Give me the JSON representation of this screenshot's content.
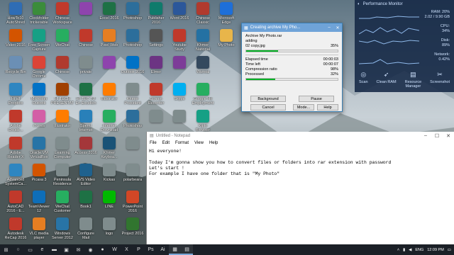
{
  "desktop_icons": [
    {
      "label": "HowTo10\nAutoShred",
      "icon": "app-icon",
      "color": "#2f6db5",
      "col": 0,
      "row": 0
    },
    {
      "label": "Clockfolder\ntrickerable",
      "icon": "app-icon",
      "color": "#3b8c3b",
      "col": 1,
      "row": 0
    },
    {
      "label": "Chinese\nWorkspace",
      "icon": "app-icon",
      "color": "#c0392b",
      "col": 2,
      "row": 0
    },
    {
      "label": "",
      "icon": "app-icon",
      "color": "#8e44ad",
      "col": 3,
      "row": 0
    },
    {
      "label": "Excel 2016",
      "icon": "excel-icon",
      "color": "#1e7145",
      "col": 4,
      "row": 0
    },
    {
      "label": "Photoshop",
      "icon": "app-icon",
      "color": "#2c6e9b",
      "col": 5,
      "row": 0
    },
    {
      "label": "Publisher\n2016",
      "icon": "app-icon",
      "color": "#0f7b6c",
      "col": 6,
      "row": 0
    },
    {
      "label": "Word 2016",
      "icon": "word-icon",
      "color": "#2b579a",
      "col": 7,
      "row": 0
    },
    {
      "label": "Chinese\nClassic",
      "icon": "app-icon",
      "color": "#b03a2e",
      "col": 8,
      "row": 0
    },
    {
      "label": "Microsoft\nEdge",
      "icon": "edge-icon",
      "color": "#1e6fd9",
      "col": 9,
      "row": 0
    },
    {
      "label": "Video 2016",
      "icon": "app-icon",
      "color": "#d35400",
      "col": 0,
      "row": 1
    },
    {
      "label": "Free Screen\nCapture",
      "icon": "app-icon",
      "color": "#16a085",
      "col": 1,
      "row": 1
    },
    {
      "label": "WeChat",
      "icon": "app-icon",
      "color": "#27ae60",
      "col": 2,
      "row": 1
    },
    {
      "label": "Chinese",
      "icon": "app-icon",
      "color": "#c0392b",
      "col": 3,
      "row": 1
    },
    {
      "label": "Pixel Web",
      "icon": "app-icon",
      "color": "#e67e22",
      "col": 4,
      "row": 1
    },
    {
      "label": "Photoshop",
      "icon": "app-icon",
      "color": "#2c6e9b",
      "col": 5,
      "row": 1
    },
    {
      "label": "Settings",
      "icon": "gear-icon",
      "color": "#555555",
      "col": 6,
      "row": 1
    },
    {
      "label": "Youtube\nStudy",
      "icon": "app-icon",
      "color": "#c0392b",
      "col": 7,
      "row": 1
    },
    {
      "label": "Khmer\nNational",
      "icon": "app-icon",
      "color": "#2471a3",
      "col": 8,
      "row": 1
    },
    {
      "label": "My Photo",
      "icon": "folder-icon",
      "color": "#e8b54a",
      "col": 9,
      "row": 1
    },
    {
      "label": "Recycle Bin",
      "icon": "recycle-bin-icon",
      "color": "#6b8fb5",
      "col": 0,
      "row": 2
    },
    {
      "label": "Google\nChrome",
      "icon": "chrome-icon",
      "color": "#db4437",
      "col": 1,
      "row": 2
    },
    {
      "label": "Chinese",
      "icon": "app-icon",
      "color": "#b03a2e",
      "col": 2,
      "row": 2
    },
    {
      "label": "private",
      "icon": "app-icon",
      "color": "#7f8c8d",
      "col": 3,
      "row": 2
    },
    {
      "label": "",
      "icon": "app-icon",
      "color": "#8e44ad",
      "col": 4,
      "row": 2
    },
    {
      "label": "Outlook 2016",
      "icon": "outlook-icon",
      "color": "#0072c6",
      "col": 5,
      "row": 2
    },
    {
      "label": "Elmer",
      "icon": "app-icon",
      "color": "#6c3483",
      "col": 6,
      "row": 2
    },
    {
      "label": "",
      "icon": "winrar-icon",
      "color": "#7d3c98",
      "col": 7,
      "row": 2
    },
    {
      "label": "Wizreal",
      "icon": "app-icon",
      "color": "#34495e",
      "col": 8,
      "row": 2
    },
    {
      "label": "Hi all\nDropbox",
      "icon": "app-icon",
      "color": "#2e86c1",
      "col": 0,
      "row": 3
    },
    {
      "label": "Microsoft\nOutlook",
      "icon": "app-icon",
      "color": "#0072c6",
      "col": 1,
      "row": 3
    },
    {
      "label": "HI TECH\nPRESENTAT",
      "icon": "app-icon",
      "color": "#a04000",
      "col": 2,
      "row": 3
    },
    {
      "label": "HI TEC TU\nEn Excellen",
      "icon": "app-icon",
      "color": "#1e7145",
      "col": 3,
      "row": 3
    },
    {
      "label": "Illustrator",
      "icon": "app-icon",
      "color": "#ff7c00",
      "col": 4,
      "row": 3
    },
    {
      "label": "Khmer\nPresident",
      "icon": "app-icon",
      "color": "#7f8c8d",
      "col": 5,
      "row": 3
    },
    {
      "label": "Screen\nRecorder",
      "icon": "app-icon",
      "color": "#c0392b",
      "col": 6,
      "row": 3
    },
    {
      "label": "Skype",
      "icon": "app-icon",
      "color": "#00aff0",
      "col": 7,
      "row": 3
    },
    {
      "label": "Google Hit\nEmployment",
      "icon": "app-icon",
      "color": "#27ae60",
      "col": 8,
      "row": 3
    },
    {
      "label": "Adobe\nCreate...",
      "icon": "app-icon",
      "color": "#c0392b",
      "col": 0,
      "row": 4
    },
    {
      "label": "iTunes",
      "icon": "app-icon",
      "color": "#d35fa6",
      "col": 1,
      "row": 4
    },
    {
      "label": "Illustrator",
      "icon": "app-icon",
      "color": "#ff7c00",
      "col": 2,
      "row": 4
    },
    {
      "label": "Speed\nInternet",
      "icon": "app-icon",
      "color": "#2980b9",
      "col": 3,
      "row": 4
    },
    {
      "label": "Internet\nDownload",
      "icon": "app-icon",
      "color": "#27ae60",
      "col": 4,
      "row": 4
    },
    {
      "label": "Photoshop",
      "icon": "app-icon",
      "color": "#2c6e9b",
      "col": 5,
      "row": 4
    },
    {
      "label": "",
      "icon": "app-icon",
      "color": "#7f8c8d",
      "col": 6,
      "row": 4
    },
    {
      "label": "",
      "icon": "app-icon",
      "color": "#7f8c8d",
      "col": 7,
      "row": 4
    },
    {
      "label": "Kiplo\nBrowser",
      "icon": "app-icon",
      "color": "#16a085",
      "col": 8,
      "row": 4
    },
    {
      "label": "Adobe\nReader X",
      "icon": "app-icon",
      "color": "#c0392b",
      "col": 0,
      "row": 5
    },
    {
      "label": "Oracle VM\nVirtualBox",
      "icon": "app-icon",
      "color": "#2874a6",
      "col": 1,
      "row": 5
    },
    {
      "label": "Learning\nComputer",
      "icon": "app-icon",
      "color": "#7f8c8d",
      "col": 2,
      "row": 5
    },
    {
      "label": "Access 2016",
      "icon": "app-icon",
      "color": "#a4373a",
      "col": 3,
      "row": 5
    },
    {
      "label": "Khmer\nKeyboa...",
      "icon": "app-icon",
      "color": "#1a5276",
      "col": 4,
      "row": 5
    },
    {
      "label": "",
      "icon": "app-icon",
      "color": "#7f8c8d",
      "col": 5,
      "row": 5
    },
    {
      "label": "Advanced\nSystemCa...",
      "icon": "app-icon",
      "color": "#2e86c1",
      "col": 0,
      "row": 6
    },
    {
      "label": "Picasa 3",
      "icon": "app-icon",
      "color": "#d35400",
      "col": 1,
      "row": 6
    },
    {
      "label": "Peninsula\nResidence",
      "icon": "app-icon",
      "color": "#7f8c8d",
      "col": 2,
      "row": 6
    },
    {
      "label": "AVS Video\nEditor",
      "icon": "app-icon",
      "color": "#1f618d",
      "col": 3,
      "row": 6
    },
    {
      "label": "Kickas",
      "icon": "app-icon",
      "color": "#7f8c8d",
      "col": 4,
      "row": 6
    },
    {
      "label": "polarbeara",
      "icon": "app-icon",
      "color": "#7f8c8d",
      "col": 5,
      "row": 6
    },
    {
      "label": "AutoCAD\n2016 - E...",
      "icon": "app-icon",
      "color": "#c0392b",
      "col": 0,
      "row": 7
    },
    {
      "label": "TeamViewer\n12",
      "icon": "app-icon",
      "color": "#0e6eb8",
      "col": 1,
      "row": 7
    },
    {
      "label": "WeChat\nCustomer",
      "icon": "app-icon",
      "color": "#27ae60",
      "col": 2,
      "row": 7
    },
    {
      "label": "Book1",
      "icon": "app-icon",
      "color": "#1e7145",
      "col": 3,
      "row": 7
    },
    {
      "label": "LINE",
      "icon": "app-icon",
      "color": "#00b900",
      "col": 4,
      "row": 7
    },
    {
      "label": "PowerPoint\n2016",
      "icon": "app-icon",
      "color": "#d24726",
      "col": 5,
      "row": 7
    },
    {
      "label": "Autodesk\nReCap 2016",
      "icon": "app-icon",
      "color": "#c0392b",
      "col": 0,
      "row": 8
    },
    {
      "label": "VLC media\nplayer",
      "icon": "app-icon",
      "color": "#e67e22",
      "col": 1,
      "row": 8
    },
    {
      "label": "Windows\nServer 2012",
      "icon": "app-icon",
      "color": "#2874a6",
      "col": 2,
      "row": 8
    },
    {
      "label": "Configure\nMail",
      "icon": "app-icon",
      "color": "#7f8c8d",
      "col": 3,
      "row": 8
    },
    {
      "label": "logo",
      "icon": "app-icon",
      "color": "#7f8c8d",
      "col": 4,
      "row": 8
    },
    {
      "label": "Project 2016",
      "icon": "app-icon",
      "color": "#31752f",
      "col": 5,
      "row": 8
    }
  ],
  "perf": {
    "title": "Performance Monitor",
    "ram_label": "RAM: 20%",
    "ram_value": "2.02 / 9.90 GB",
    "cpu_label": "CPU:",
    "cpu_value": "34%",
    "disk_label": "Disk:",
    "disk_value": "89%",
    "network_label": "Network:",
    "network_value": "0.42%",
    "buttons": [
      {
        "label": "Scan",
        "icon": "scan-icon",
        "glyph": "◎"
      },
      {
        "label": "Clean RAM",
        "icon": "rocket-icon",
        "glyph": "➶"
      },
      {
        "label": "Resource\nManager",
        "icon": "resource-icon",
        "glyph": "▤"
      },
      {
        "label": "Screenshot",
        "icon": "screenshot-icon",
        "glyph": "✂"
      }
    ]
  },
  "rar": {
    "title": "Creating archive My Pho...",
    "archive": "Archive My Photo.rar",
    "action": "adding",
    "file": "02 copy.jpg",
    "file_pct": "35%",
    "file_progress": 0.35,
    "elapsed_label": "Elapsed time",
    "elapsed": "00:00:03",
    "left_label": "Time left",
    "left": "00:00:07",
    "ratio_label": "Compression ratio",
    "ratio": "98%",
    "processed_label": "Processed",
    "processed": "32%",
    "processed_progress": 0.32,
    "btn_background": "Background",
    "btn_pause": "Pause",
    "btn_cancel": "Cancel",
    "btn_mode": "Mode...",
    "btn_help": "Help"
  },
  "notepad": {
    "title": "Untitled - Notepad",
    "menu": [
      "File",
      "Edit",
      "Format",
      "View",
      "Help"
    ],
    "lines": [
      "Hi everyone!",
      "",
      "Today I'm gonna show you how to convert files or folders into rar extension with password",
      "Let's start !",
      "For example I have one folder that is \"My Photo\""
    ]
  },
  "taskbar": {
    "items": [
      {
        "icon": "windows-start-icon",
        "glyph": "⊞"
      },
      {
        "icon": "search-icon",
        "glyph": "○"
      },
      {
        "icon": "task-view-icon",
        "glyph": "▭"
      },
      {
        "icon": "edge-icon",
        "glyph": "e"
      },
      {
        "icon": "file-explorer-icon",
        "glyph": "▬"
      },
      {
        "icon": "store-icon",
        "glyph": "▣"
      },
      {
        "icon": "mail-icon",
        "glyph": "✉"
      },
      {
        "icon": "chrome-icon",
        "glyph": "◉"
      },
      {
        "icon": "firefox-icon",
        "glyph": "●"
      },
      {
        "icon": "word-icon",
        "glyph": "W"
      },
      {
        "icon": "excel-icon",
        "glyph": "X"
      },
      {
        "icon": "powerpoint-icon",
        "glyph": "P"
      },
      {
        "icon": "photoshop-icon",
        "glyph": "Ps"
      },
      {
        "icon": "illustrator-icon",
        "glyph": "Ai"
      },
      {
        "icon": "winrar-icon",
        "glyph": "▦"
      },
      {
        "icon": "notepad-icon",
        "glyph": "▤"
      }
    ],
    "lang": "ENG",
    "time": "12:09 PM",
    "date": ""
  }
}
